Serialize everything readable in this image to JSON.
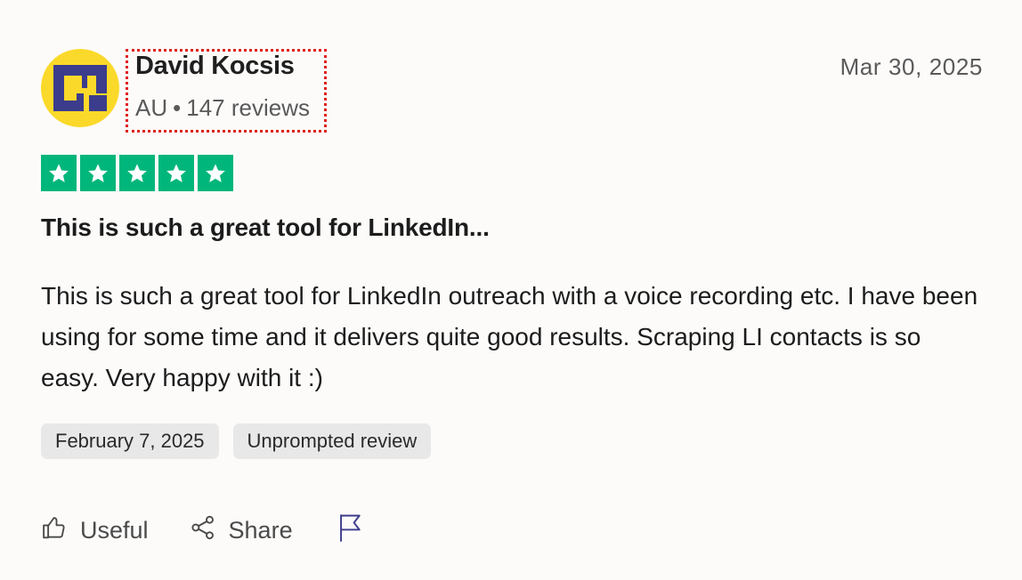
{
  "author": {
    "name": "David Kocsis",
    "country": "AU",
    "separator": "•",
    "reviews_count": "147 reviews",
    "avatar_icon": "gm-logo-avatar"
  },
  "review": {
    "date": "Mar 30, 2025",
    "rating": 5,
    "rating_color": "#00b67a",
    "title": "This is such a great tool for LinkedIn...",
    "body": "This is such a great tool for LinkedIn outreach with a voice recording etc. I have been using for some time and it delivers quite good results. Scraping LI contacts is so easy. Very happy with it :)"
  },
  "tags": [
    "February 7, 2025",
    "Unprompted review"
  ],
  "actions": {
    "useful_label": "Useful",
    "useful_icon": "thumbs-up-icon",
    "share_label": "Share",
    "share_icon": "share-icon",
    "report_icon": "flag-icon"
  },
  "colors": {
    "avatar_bg": "#fbd92a",
    "avatar_logo": "#3c3c8c",
    "highlight_border": "#e0201b"
  }
}
